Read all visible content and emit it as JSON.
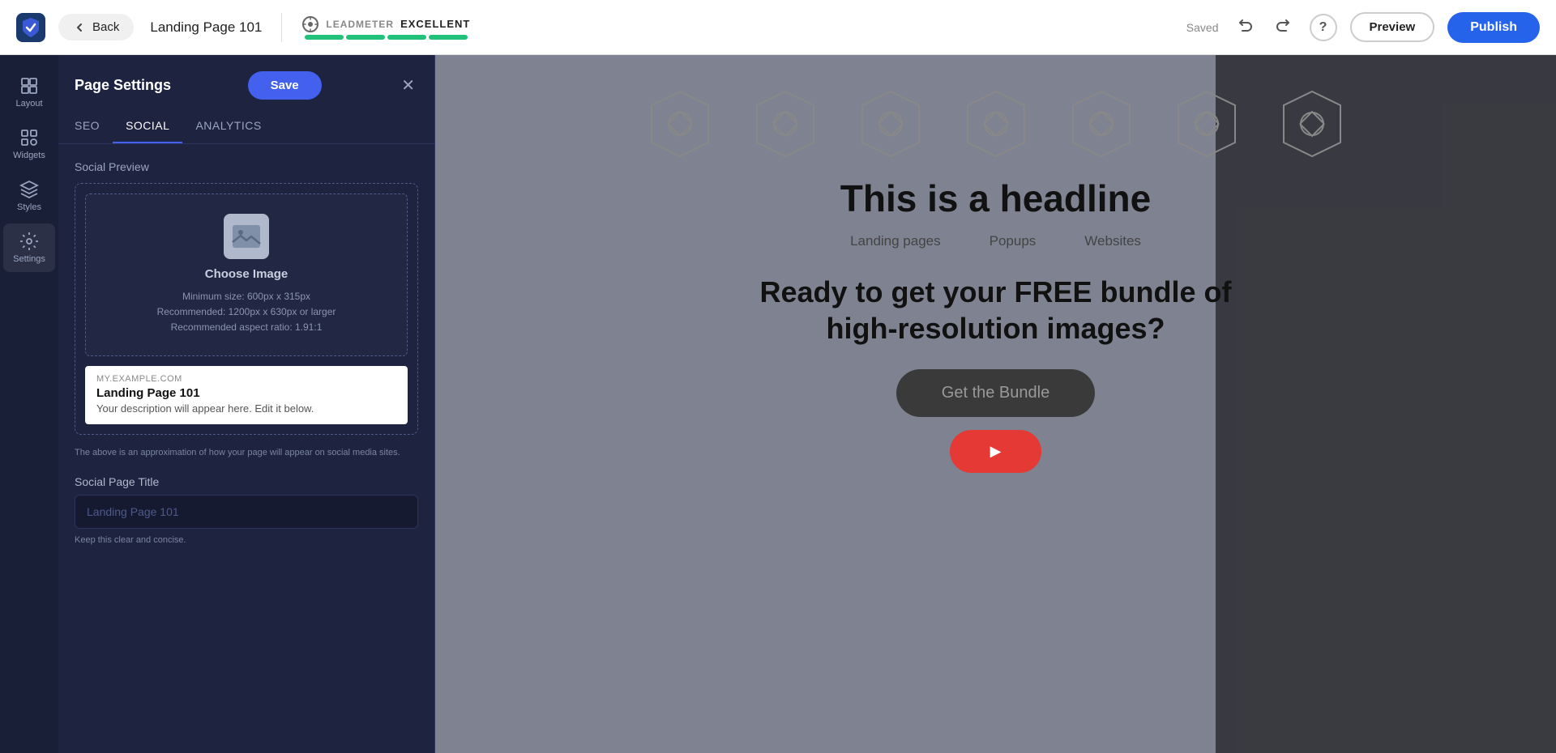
{
  "header": {
    "back_label": "Back",
    "page_title": "Landing Page 101",
    "leadmeter_label": "LEADMETER",
    "leadmeter_status": "EXCELLENT",
    "saved_label": "Saved",
    "preview_label": "Preview",
    "publish_label": "Publish",
    "help_label": "?"
  },
  "sidebar": {
    "items": [
      {
        "id": "layout",
        "label": "Layout"
      },
      {
        "id": "widgets",
        "label": "Widgets"
      },
      {
        "id": "styles",
        "label": "Styles"
      },
      {
        "id": "settings",
        "label": "Settings"
      }
    ]
  },
  "settings_panel": {
    "title": "Page Settings",
    "save_label": "Save",
    "tabs": [
      {
        "id": "seo",
        "label": "SEO"
      },
      {
        "id": "social",
        "label": "SOCIAL"
      },
      {
        "id": "analytics",
        "label": "ANALYTICS"
      }
    ],
    "active_tab": "social",
    "social_preview_label": "Social Preview",
    "choose_image_label": "Choose Image",
    "image_min_size": "Minimum size: 600px x 315px",
    "image_recommended": "Recommended: 1200px x 630px or larger",
    "image_aspect": "Recommended aspect ratio: 1.91:1",
    "social_domain": "MY.EXAMPLE.COM",
    "social_page_title_preview": "Landing Page 101",
    "social_description_preview": "Your description will appear here. Edit it below.",
    "approximation_note": "The above is an approximation of how your page will appear on social media sites.",
    "page_title_field_label": "Social Page Title",
    "page_title_placeholder": "Landing Page 101",
    "page_title_hint": "Keep this clear and concise."
  },
  "canvas": {
    "headline": "This is a headline",
    "sub_items": [
      "Landing pages",
      "Popups",
      "Websites"
    ],
    "bundle_headline": "Ready to get your FREE bundle of high-resolution images?",
    "get_bundle_label": "Get the Bundle"
  }
}
